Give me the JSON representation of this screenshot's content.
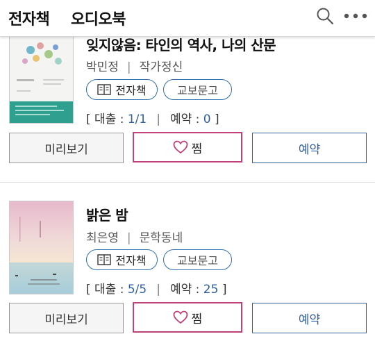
{
  "tabs": [
    "전자책",
    "오디오북"
  ],
  "books": [
    {
      "title": "잊지않음: 타인의 역사, 나의 산문",
      "author": "박민정",
      "publisher": "작가정신",
      "format_label": "전자책",
      "supplier": "교보문고",
      "loan_label": "[ 대출 : ",
      "loan": "1/1",
      "reserve_label": "예약 : ",
      "reserve": "0",
      "close": " ]",
      "preview_button": "미리보기",
      "wish_button": "찜",
      "reserve_button": "예약"
    },
    {
      "title": "밝은 밤",
      "author": "최은영",
      "publisher": "문학동네",
      "format_label": "전자책",
      "supplier": "교보문고",
      "loan_label": "[ 대출 : ",
      "loan": "5/5",
      "reserve_label": "예약 : ",
      "reserve": "25",
      "close": " ]",
      "preview_button": "미리보기",
      "wish_button": "찜",
      "reserve_button": "예약"
    }
  ],
  "colors": {
    "accent_blue": "#2f5f9e",
    "wish_pink": "#c0407a"
  }
}
